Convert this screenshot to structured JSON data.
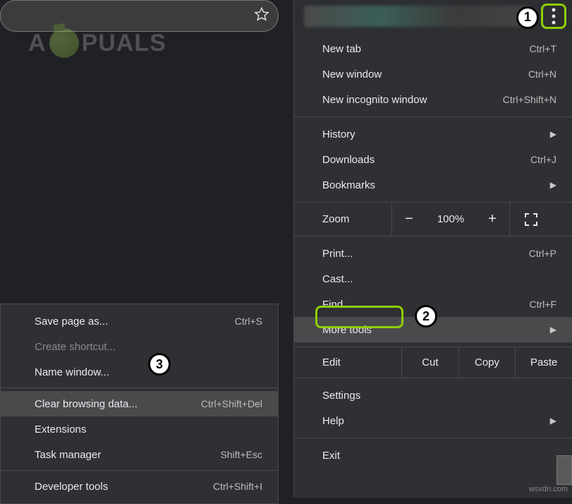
{
  "logo_text_left": "A",
  "logo_text_right": "PUALS",
  "callouts": {
    "c1": "1",
    "c2": "2",
    "c3": "3"
  },
  "main_menu": {
    "sec1": [
      {
        "label": "New tab",
        "shortcut": "Ctrl+T"
      },
      {
        "label": "New window",
        "shortcut": "Ctrl+N"
      },
      {
        "label": "New incognito window",
        "shortcut": "Ctrl+Shift+N"
      }
    ],
    "sec2": [
      {
        "label": "History",
        "arrow": true
      },
      {
        "label": "Downloads",
        "shortcut": "Ctrl+J"
      },
      {
        "label": "Bookmarks",
        "arrow": true
      }
    ],
    "zoom": {
      "label": "Zoom",
      "minus": "−",
      "pct": "100%",
      "plus": "+"
    },
    "sec3": [
      {
        "label": "Print...",
        "shortcut": "Ctrl+P"
      },
      {
        "label": "Cast..."
      },
      {
        "label": "Find...",
        "shortcut": "Ctrl+F"
      },
      {
        "label": "More tools",
        "arrow": true,
        "highlight": true
      }
    ],
    "edit": {
      "label": "Edit",
      "cut": "Cut",
      "copy": "Copy",
      "paste": "Paste"
    },
    "sec4": [
      {
        "label": "Settings"
      },
      {
        "label": "Help",
        "arrow": true
      }
    ],
    "sec5": [
      {
        "label": "Exit"
      }
    ]
  },
  "sub_menu": {
    "top": [
      {
        "label": "Save page as...",
        "shortcut": "Ctrl+S"
      },
      {
        "label": "Create shortcut...",
        "disabled": true
      },
      {
        "label": "Name window..."
      }
    ],
    "mid": [
      {
        "label": "Clear browsing data...",
        "shortcut": "Ctrl+Shift+Del",
        "highlight": true
      },
      {
        "label": "Extensions"
      },
      {
        "label": "Task manager",
        "shortcut": "Shift+Esc"
      }
    ],
    "bot": [
      {
        "label": "Developer tools",
        "shortcut": "Ctrl+Shift+I"
      }
    ]
  },
  "watermark": "wsxdn.com"
}
